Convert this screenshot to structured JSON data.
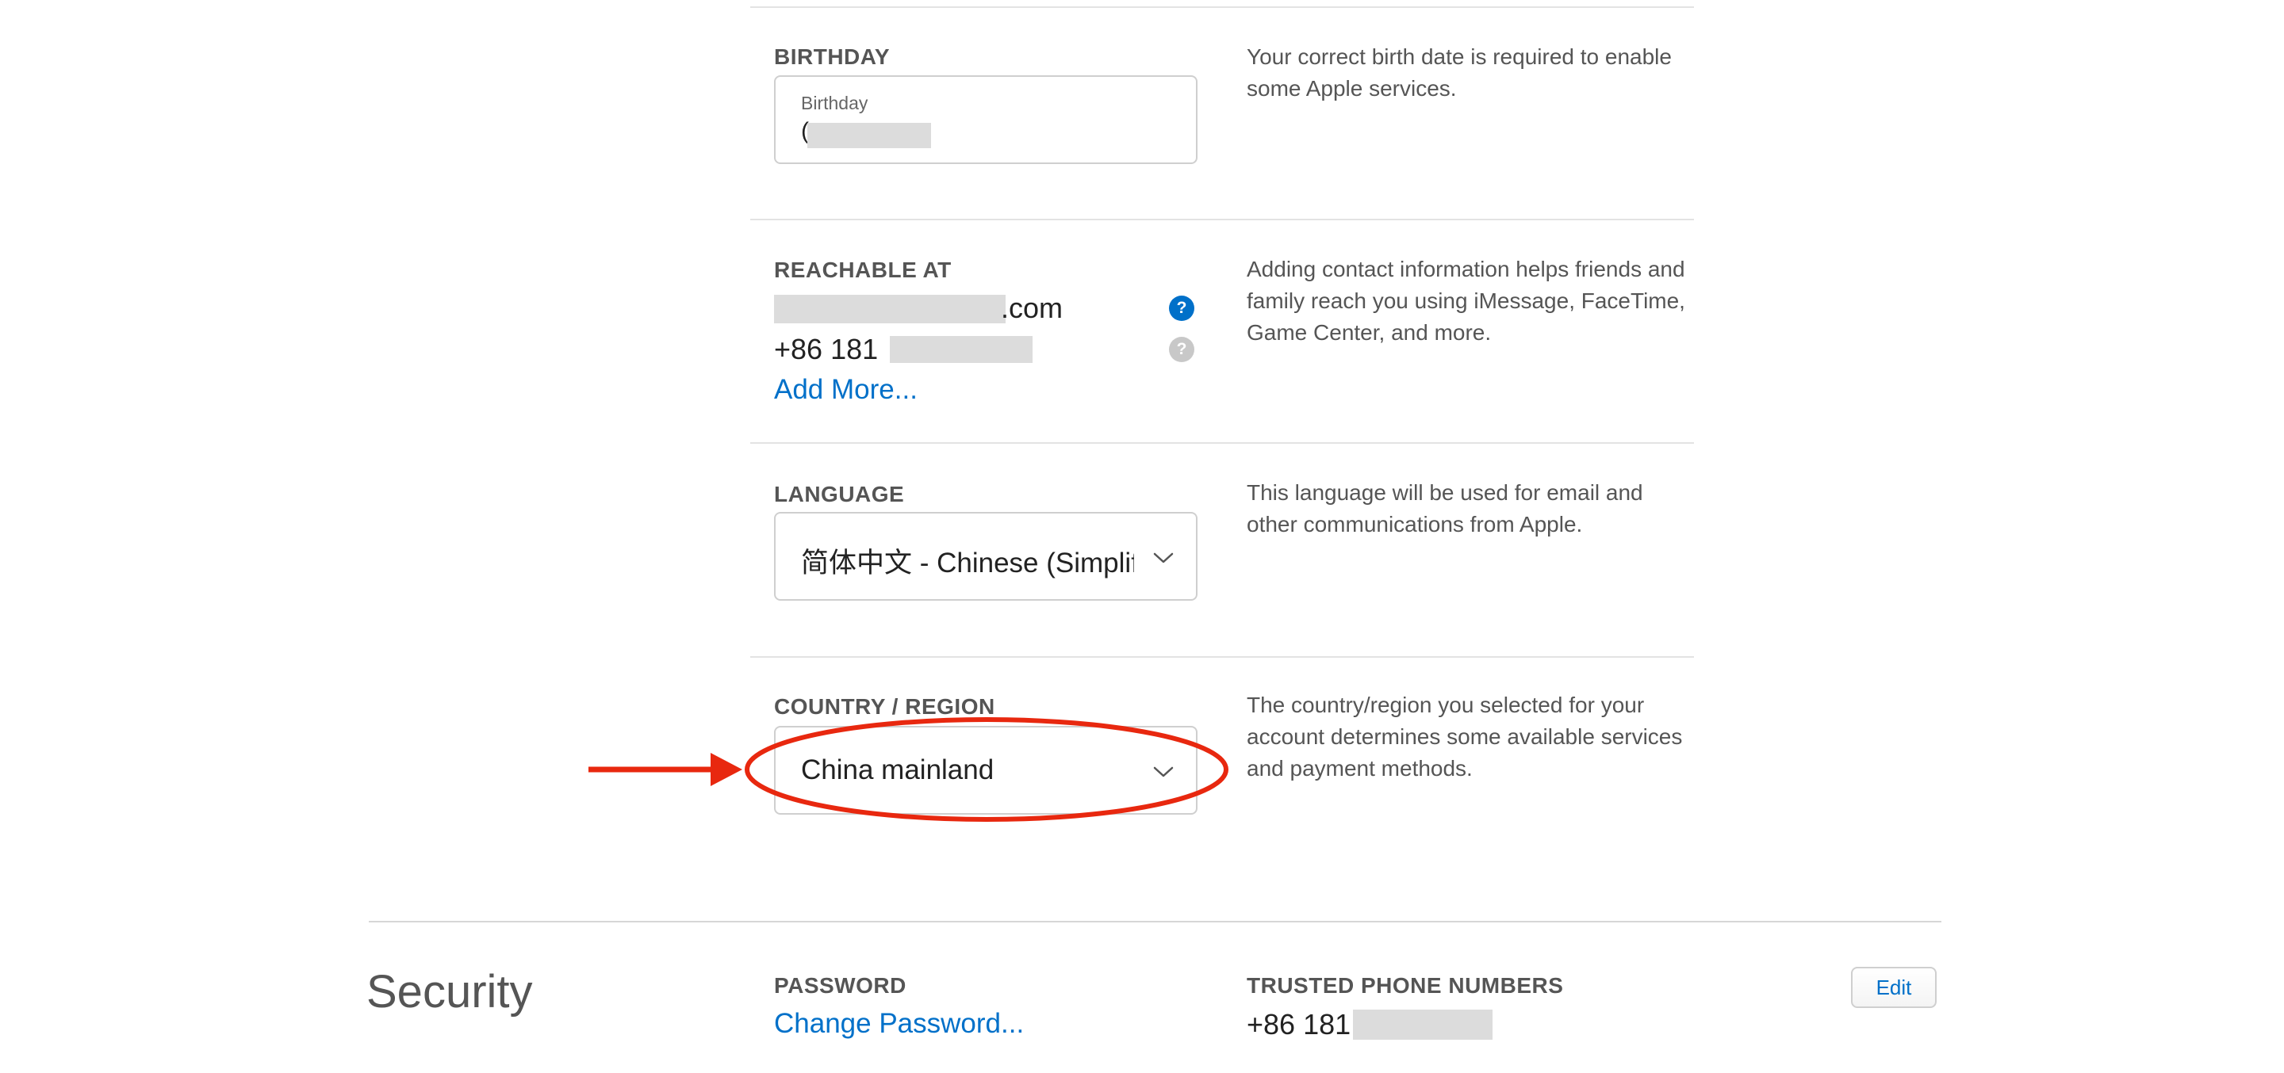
{
  "personal": {
    "birthday": {
      "section_label": "BIRTHDAY",
      "field_label": "Birthday",
      "value_prefix": "(",
      "description": "Your correct birth date is required to enable some Apple services."
    },
    "reachable": {
      "section_label": "REACHABLE AT",
      "email_suffix": ".com",
      "phone_prefix": "+86 181",
      "add_more_label": "Add More...",
      "help_icon_primary": "?",
      "help_icon_secondary": "?",
      "description": "Adding contact information helps friends and family reach you using iMessage, FaceTime, Game Center, and more."
    },
    "language": {
      "section_label": "LANGUAGE",
      "selected": "简体中文 - Chinese (Simplified)",
      "description": "This language will be used for email and other communications from Apple."
    },
    "country": {
      "section_label": "COUNTRY / REGION",
      "selected": "China mainland",
      "description": "The country/region you selected for your account determines some available services and payment methods."
    }
  },
  "security": {
    "heading": "Security",
    "password_label": "PASSWORD",
    "change_password_label": "Change Password...",
    "trusted_label": "TRUSTED PHONE NUMBERS",
    "trusted_phone_prefix": "+86 181",
    "edit_label": "Edit"
  },
  "colors": {
    "link": "#0070c9",
    "annotation": "#e8280f",
    "help_primary": "#0070c9",
    "help_secondary": "#c8c8c8"
  },
  "icons": {
    "help": "question-circle-icon",
    "chevron": "chevron-down-icon",
    "annotation_arrow": "arrow-right-icon",
    "annotation_circle": "ellipse-highlight"
  }
}
